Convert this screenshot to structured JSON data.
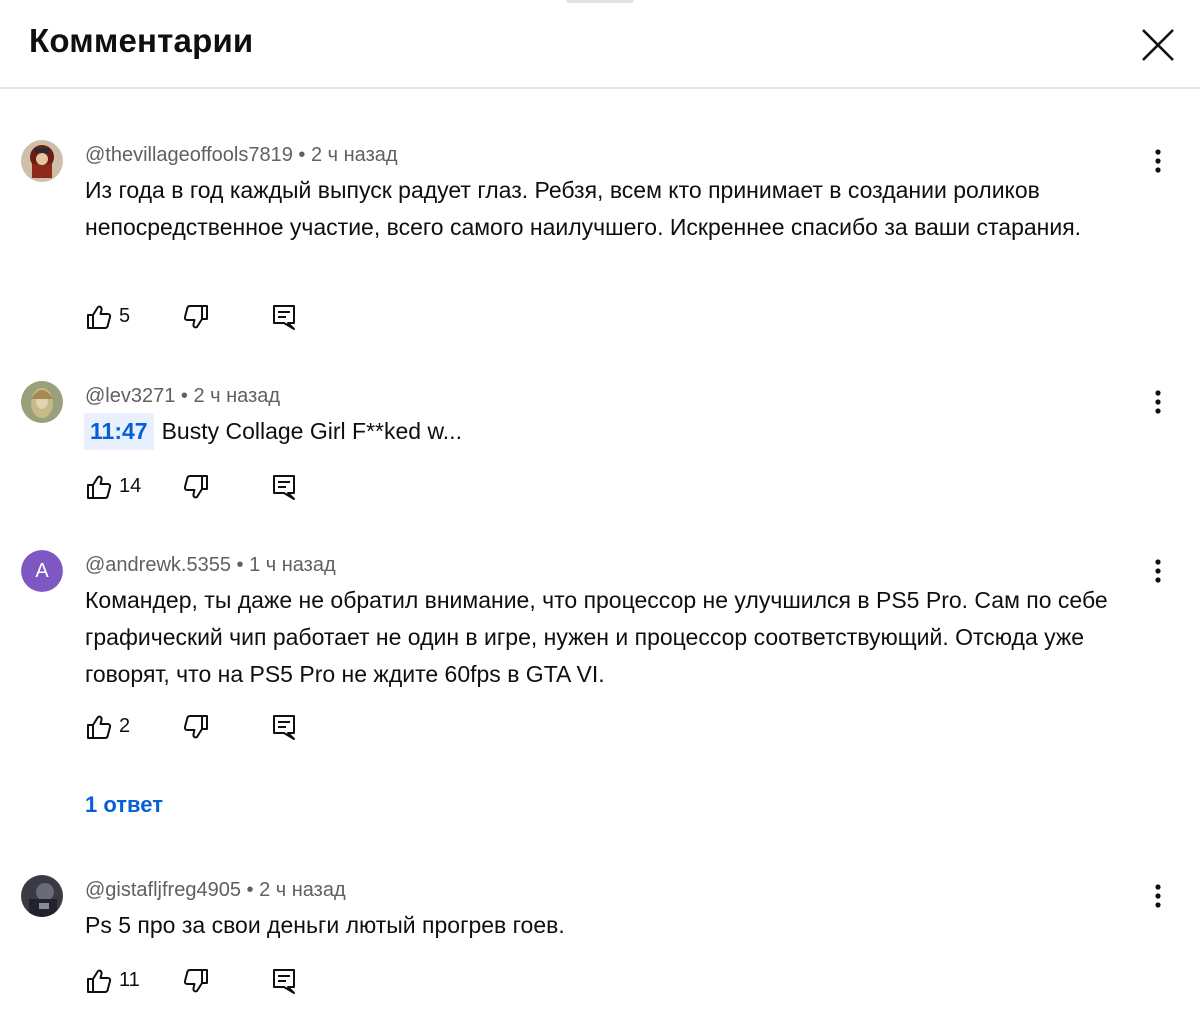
{
  "header": {
    "title": "Комментарии",
    "close_icon": "close-icon"
  },
  "comments": [
    {
      "author": "@thevillageoffools7819",
      "time": "2 ч назад",
      "meta": "@thevillageoffools7819 • 2 ч назад",
      "text": "Из года в год каждый выпуск радует глаз. Ребзя, всем кто принимает в создании роликов непосредственное участие, всего самого наилучшего. Искреннее спасибо за ваши старания.",
      "likes": "5"
    },
    {
      "author": "@lev3271",
      "time": "2 ч назад",
      "meta": "@lev3271 • 2 ч назад",
      "timestamp": "11:47",
      "text": "Busty Collage Girl F**ked w...",
      "likes": "14"
    },
    {
      "author": "@andrewk.5355",
      "time": "1 ч назад",
      "meta": "@andrewk.5355 • 1 ч назад",
      "avatar_letter": "A",
      "avatar_color": "#7e57c2",
      "text": "Командер, ты даже не обратил внимание, что процессор не улучшился в PS5 Pro. Сам по себе графический чип работает не один в игре, нужен и процессор соответствующий. Отсюда уже говорят, что на PS5 Pro не ждите 60fps в GTA VI.",
      "likes": "2",
      "replies_label": "1 ответ"
    },
    {
      "author": "@gistafljfreg4905",
      "time": "2 ч назад",
      "meta": "@gistafljfreg4905 • 2 ч назад",
      "text": "Ps 5 про за свои деньги лютый прогрев гоев.",
      "likes": "11"
    }
  ],
  "icons": {
    "like": "thumbs-up-icon",
    "dislike": "thumbs-down-icon",
    "reply": "reply-icon",
    "more": "more-vert-icon"
  },
  "colors": {
    "link": "#065fd4",
    "timestamp_bg": "#e8f0fe",
    "meta_text": "#606060",
    "divider": "#e5e5e5"
  }
}
